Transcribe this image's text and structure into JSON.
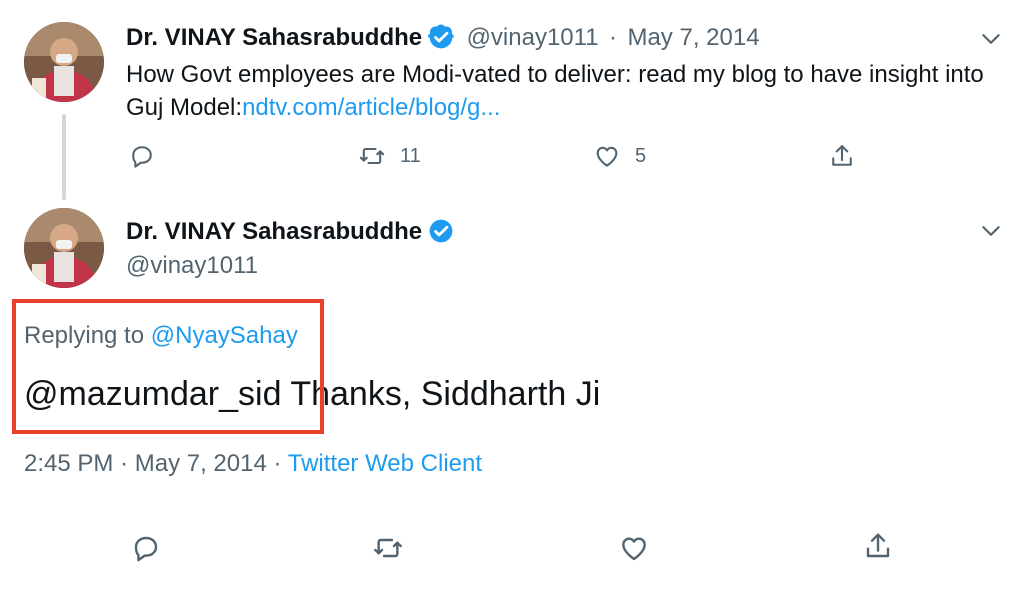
{
  "parent_tweet": {
    "author_name": "Dr. VINAY Sahasrabuddhe",
    "handle": "@vinay1011",
    "separator": "·",
    "date": "May 7, 2014",
    "text": "How Govt employees are Modi-vated to deliver: read my blog to have insight into Guj Model:",
    "link_text": "ndtv.com/article/blog/g...",
    "retweet_count": "11",
    "like_count": "5"
  },
  "main_tweet": {
    "author_name": "Dr. VINAY Sahasrabuddhe",
    "handle": "@vinay1011",
    "replying_prefix": "Replying to",
    "replying_handle": "@NyaySahay",
    "mention": "@mazumdar_sid",
    "text": " Thanks, Siddharth Ji",
    "time": "2:45 PM",
    "meta_separator": "·",
    "date": "May 7, 2014",
    "client_separator": "·",
    "client": "Twitter Web Client"
  },
  "colors": {
    "accent": "#1d9bf0",
    "highlight": "#e8402f",
    "muted": "#536471"
  },
  "icons": [
    "verified-badge-icon",
    "chevron-down-icon",
    "reply-icon",
    "retweet-icon",
    "like-icon",
    "share-icon"
  ]
}
